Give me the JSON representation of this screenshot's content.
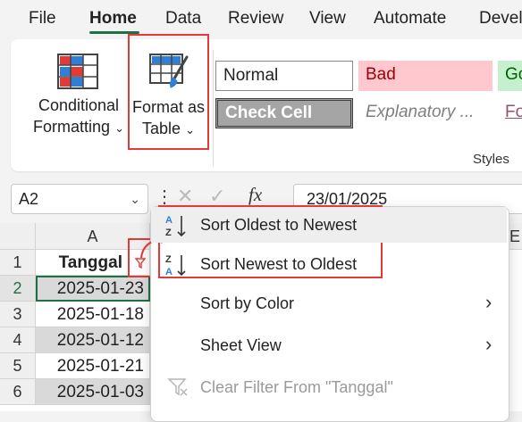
{
  "menu": {
    "file": "File",
    "home": "Home",
    "data": "Data",
    "review": "Review",
    "view": "View",
    "automate": "Automate",
    "developer": "Devel"
  },
  "ribbon": {
    "conditional_formatting": {
      "line1": "Conditional",
      "line2": "Formatting"
    },
    "format_as_table": {
      "line1": "Format as",
      "line2": "Table"
    },
    "styles": {
      "normal": "Normal",
      "bad": "Bad",
      "good": "Go",
      "check_cell": "Check Cell",
      "explanatory": "Explanatory ...",
      "followed": "Fo"
    },
    "group_label": "Styles"
  },
  "formula_bar": {
    "name_box": "A2",
    "fx": "fx",
    "value": "23/01/2025"
  },
  "grid": {
    "col_a": "A",
    "col_e": "E",
    "rows": [
      {
        "num": "1",
        "value": "Tanggal"
      },
      {
        "num": "2",
        "value": "2025-01-23"
      },
      {
        "num": "3",
        "value": "2025-01-18"
      },
      {
        "num": "4",
        "value": "2025-01-12"
      },
      {
        "num": "5",
        "value": "2025-01-21"
      },
      {
        "num": "6",
        "value": "2025-01-03"
      }
    ]
  },
  "context_menu": {
    "sort_oldest": "Sort Oldest to Newest",
    "sort_newest": "Sort Newest to Oldest",
    "sort_color": "Sort by Color",
    "sheet_view": "Sheet View",
    "clear_filter": "Clear Filter From \"Tanggal\""
  },
  "colors": {
    "accent": "#1e7145",
    "highlight": "#e53935",
    "bad_bg": "#ffc7ce",
    "bad_text": "#9c0006",
    "good_bg": "#c6efce",
    "check_cell_bg": "#a5a5a5"
  }
}
